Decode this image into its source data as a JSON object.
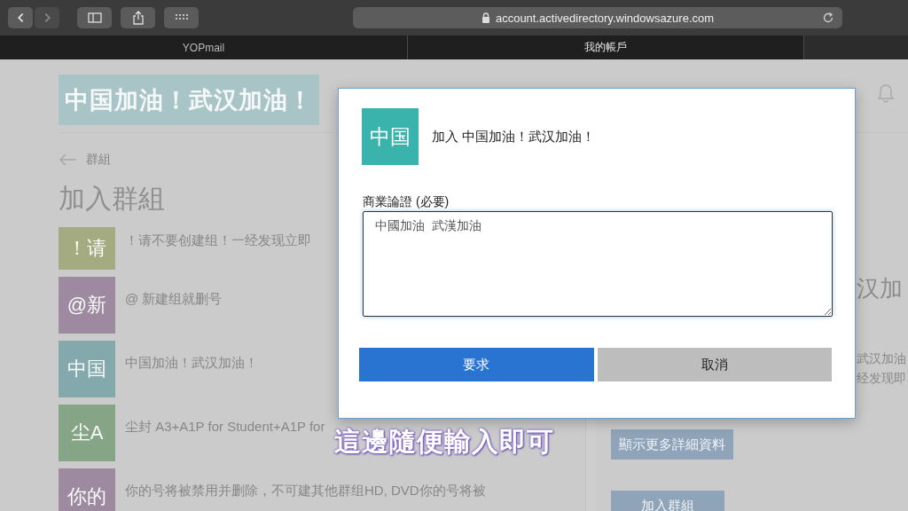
{
  "browser": {
    "nav": [
      {
        "kind": "back",
        "disabled": false
      },
      {
        "kind": "forward",
        "disabled": true
      }
    ],
    "address": "account.activedirectory.windowsazure.com"
  },
  "tabs": [
    {
      "label": "YOPmail",
      "selected": false
    },
    {
      "label": "我的帳戶",
      "selected": true
    }
  ],
  "page": {
    "logo": "中国加油！武汉加油！",
    "back_link": "群組",
    "heading": "加入群組",
    "groups": [
      {
        "tile": "！请",
        "name": "！请不要创建组！一经发现立即",
        "color": "#a5ab80"
      },
      {
        "tile": "@新",
        "name": "@ 新建组就删号",
        "color": "#9d8aa0"
      },
      {
        "tile": "中国",
        "name": "中国加油！武汉加油！",
        "color": "#84a9ad"
      },
      {
        "tile": "尘A",
        "name": "尘封 A3+A1P for Student+A1P for",
        "color": "#86a586"
      },
      {
        "tile": "你的",
        "name": "你的号将被禁用并删除，不可建其他群组HD, DVD你的号将被",
        "color": "#9d8aa0"
      }
    ],
    "details": {
      "title": "汉加",
      "lines": [
        "武汉加油",
        "经发现即"
      ],
      "buttons": [
        "顯示更多詳細資料",
        "加入群組"
      ]
    }
  },
  "dialog": {
    "tile": "中国",
    "title": "加入 中国加油！武汉加油！",
    "field_label": "商業論證 (必要)",
    "field_value": "中國加油  武漢加油",
    "buttons": [
      {
        "label": "要求",
        "kind": "primary"
      },
      {
        "label": "取消",
        "kind": "secondary"
      }
    ]
  },
  "caption": "這邊隨便輸入即可"
}
